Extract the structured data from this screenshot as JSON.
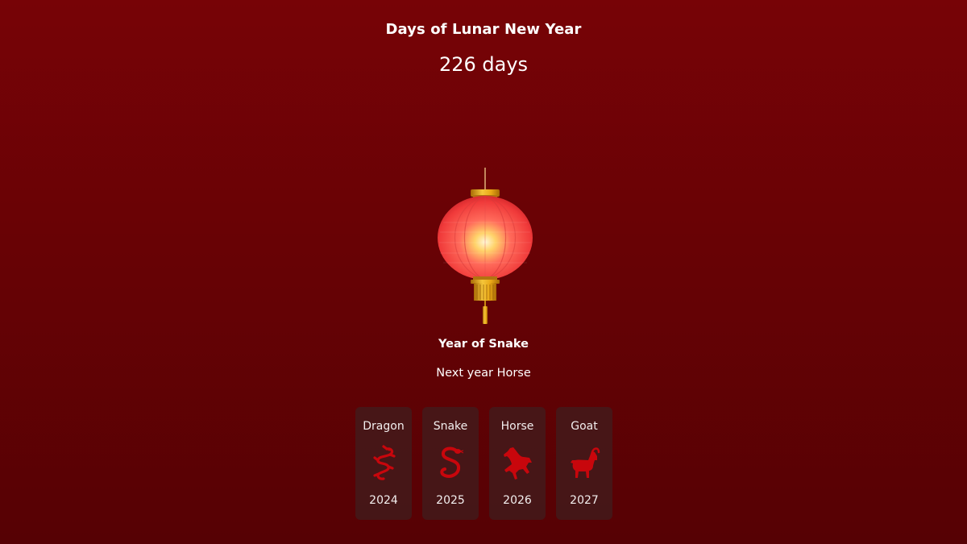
{
  "header": {
    "title": "Days of Lunar New Year",
    "countdown": "226 days"
  },
  "lantern": {
    "icon": "red-lantern-icon"
  },
  "current": {
    "year_title": "Year of Snake",
    "next_year": "Next year Horse"
  },
  "zodiac_cards": [
    {
      "name": "Dragon",
      "year": "2024",
      "icon": "dragon-icon"
    },
    {
      "name": "Snake",
      "year": "2025",
      "icon": "snake-icon"
    },
    {
      "name": "Horse",
      "year": "2026",
      "icon": "horse-icon"
    },
    {
      "name": "Goat",
      "year": "2027",
      "icon": "goat-icon"
    }
  ],
  "colors": {
    "background": "#6b0205",
    "card_background": "#3a2424",
    "zodiac_red": "#c8060c",
    "lantern_red": "#f03a3a",
    "lantern_gold": "#d79a12"
  }
}
